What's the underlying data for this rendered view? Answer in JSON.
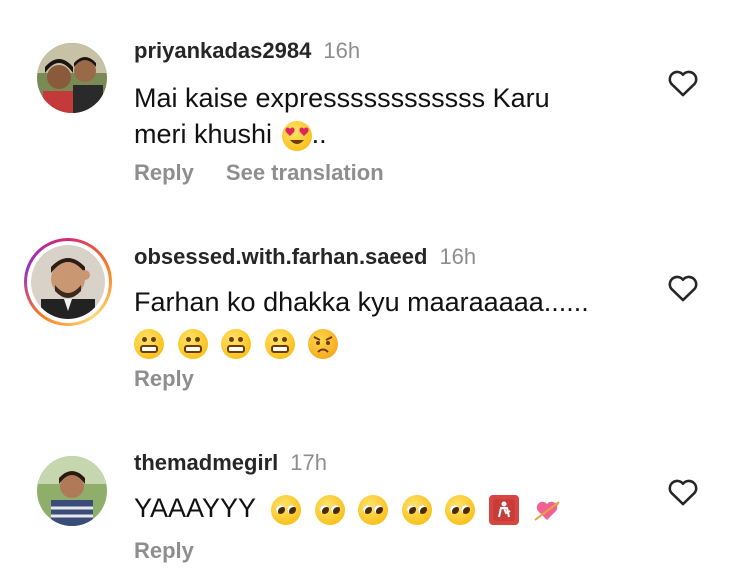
{
  "comments": [
    {
      "username": "priyankadas2984",
      "time": "16h",
      "text_line1": "Mai kaise expressssssssssss Karu",
      "text_line2": "meri khushi",
      "text_line2_suffix": "..",
      "reply_label": "Reply",
      "translation_label": "See translation",
      "avatar_icon": "couple-photo-avatar",
      "has_story_ring": false
    },
    {
      "username": "obsessed.with.farhan.saeed",
      "time": "16h",
      "text_line1": "Farhan ko dhakka kyu maaraaaaa......",
      "emoji_line": [
        "grimacing-face-icon",
        "grimacing-face-icon",
        "grimacing-face-icon",
        "grimacing-face-icon",
        "angry-face-icon"
      ],
      "reply_label": "Reply",
      "avatar_icon": "man-photo-avatar",
      "has_story_ring": true
    },
    {
      "username": "themadmegirl",
      "time": "17h",
      "text_line1": "YAAAYYY",
      "emoji_line": [
        "pleading-face-icon",
        "pleading-face-icon",
        "pleading-face-icon",
        "pleading-face-icon",
        "pleading-face-icon",
        "place-of-worship-icon",
        "heart-with-arrow-icon"
      ],
      "reply_label": "Reply",
      "avatar_icon": "woman-photo-avatar",
      "has_story_ring": false
    }
  ],
  "colors": {
    "username": "#262626",
    "secondary": "#8e8e8e",
    "ring_gradient": [
      "#d62976",
      "#fa7e1e",
      "#feda75",
      "#962fbf"
    ]
  }
}
